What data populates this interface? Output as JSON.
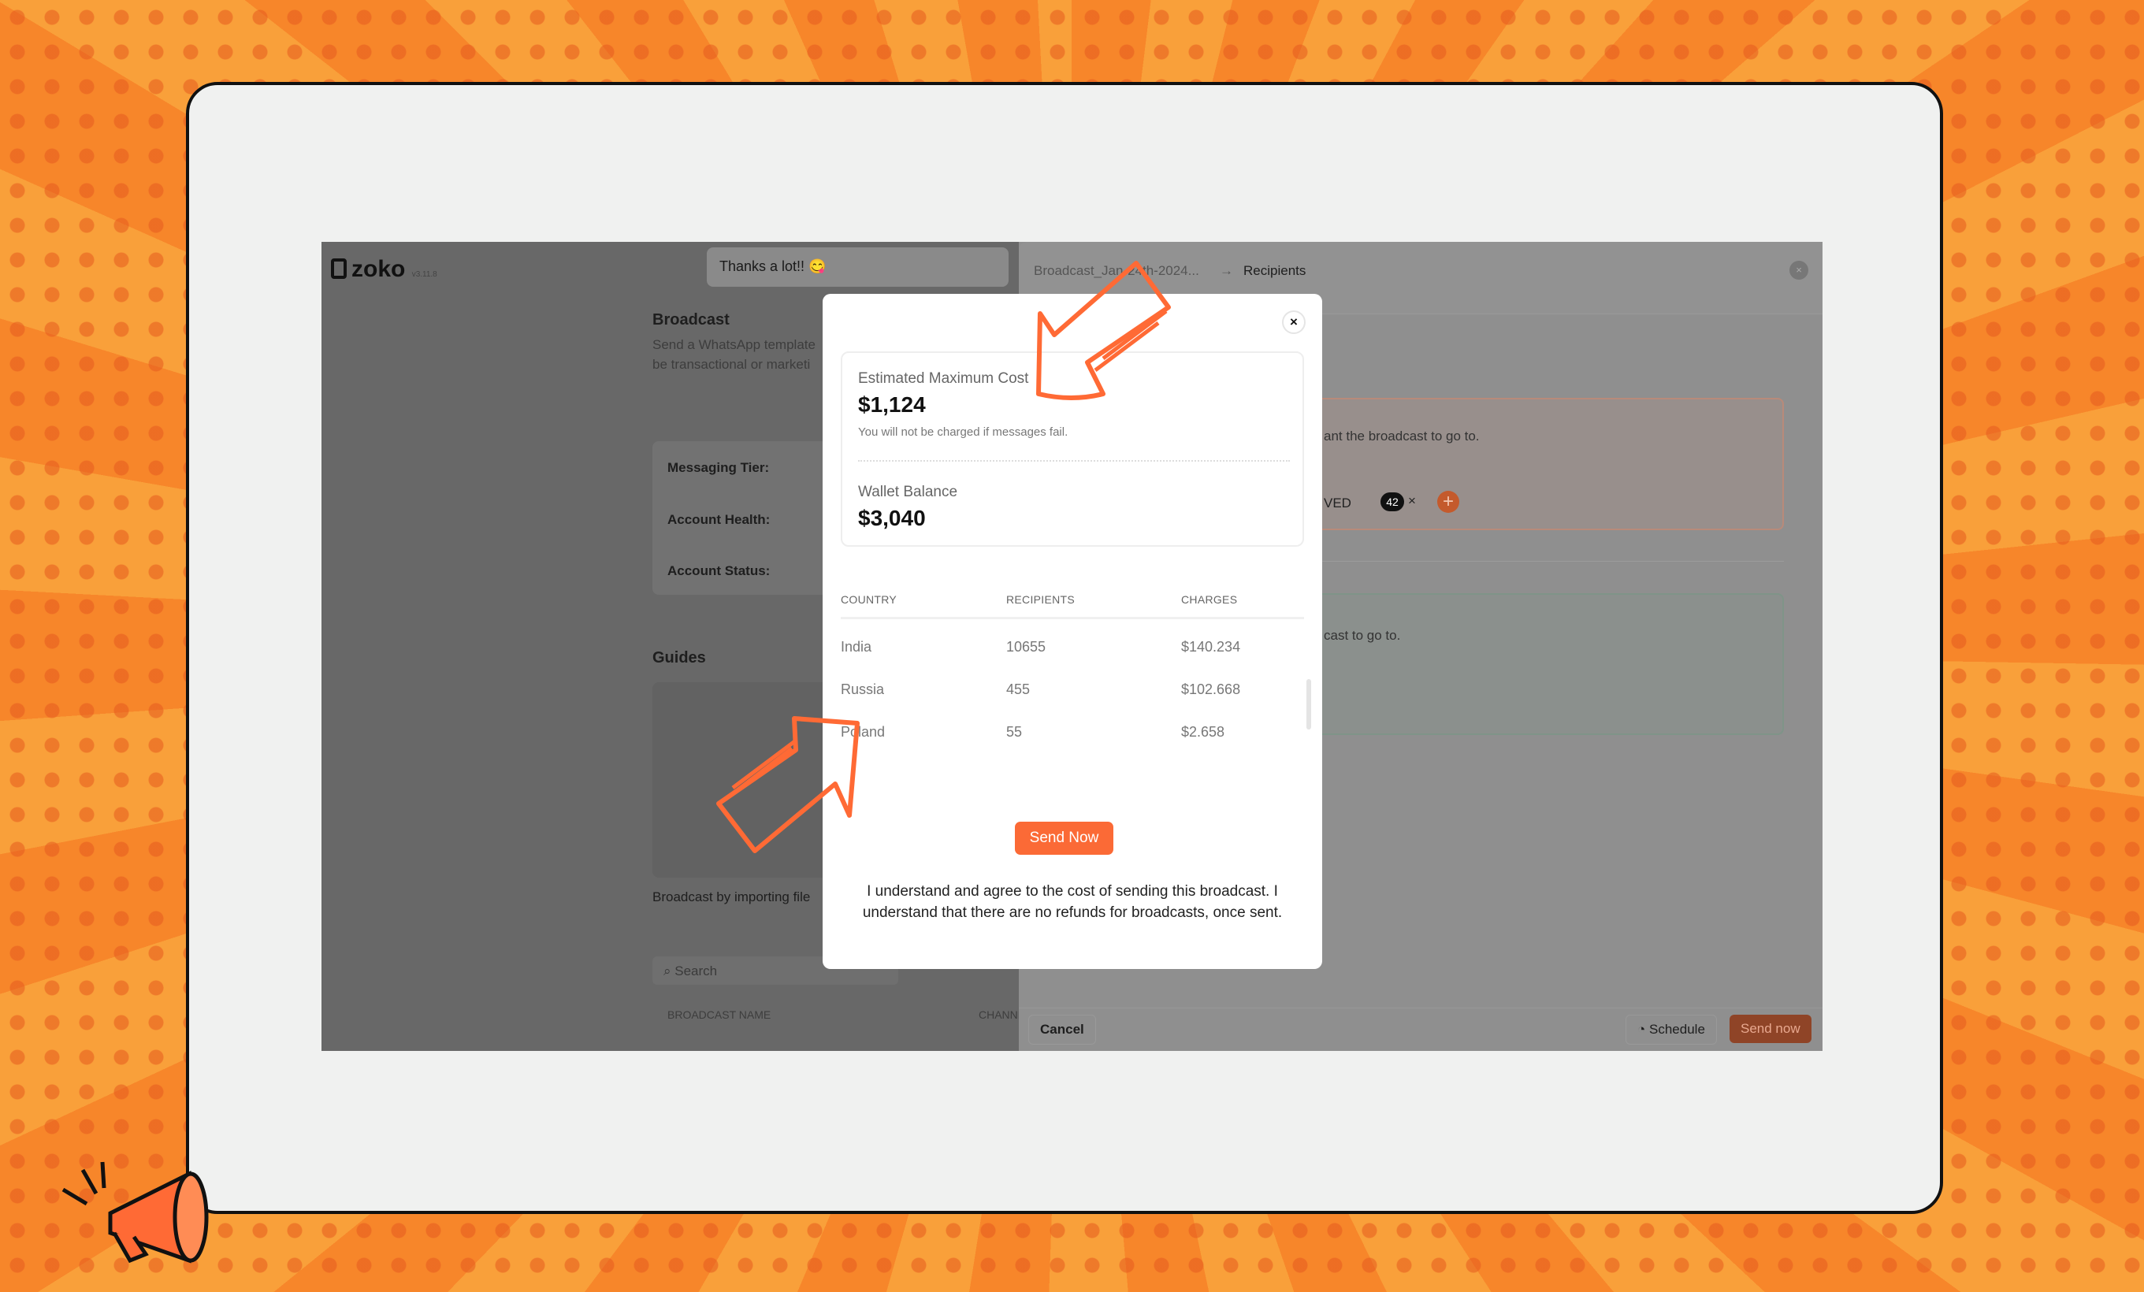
{
  "app": {
    "logo": "zoko",
    "version": "v3.11.8",
    "message_preview": "Thanks a lot!! 😋"
  },
  "left": {
    "title": "Broadcast",
    "desc1": "Send a WhatsApp template",
    "desc2": "be transactional or marketi",
    "tier_label": "Messaging Tier:",
    "health_label": "Account Health:",
    "status_label": "Account Status:",
    "guides_title": "Guides",
    "guide_caption": "Broadcast by importing file",
    "search_placeholder": "Search",
    "col_name": "BROADCAST NAME",
    "col_channel": "CHANNEL"
  },
  "right": {
    "breadcrumb_parent": "Broadcast_Jan-24th-2024...",
    "breadcrumb_current": "Recipients",
    "orange_box_text": "ant the broadcast to go to.",
    "chip_label": "VED",
    "chip_count": "42",
    "green_box_text": "cast to go to.",
    "cancel": "Cancel",
    "schedule": "Schedule",
    "send_now": "Send now"
  },
  "modal": {
    "close": "×",
    "est_label": "Estimated Maximum Cost",
    "est_value": "$1,124",
    "note": "You will not be charged if messages fail.",
    "wallet_label": "Wallet Balance",
    "wallet_value": "$3,040",
    "columns": [
      "COUNTRY",
      "RECIPIENTS",
      "CHARGES"
    ],
    "rows": [
      [
        "India",
        "10655",
        "$140.234"
      ],
      [
        "Russia",
        "455",
        "$102.668"
      ],
      [
        "Poland",
        "55",
        "$2.658"
      ]
    ],
    "send_button": "Send Now",
    "disclaimer": "I understand and agree to the cost of sending this broadcast. I understand that there are no refunds for broadcasts, once sent."
  },
  "colors": {
    "accent": "#fb6a36",
    "annotation": "#ff6a35",
    "background": "#f7862a"
  }
}
